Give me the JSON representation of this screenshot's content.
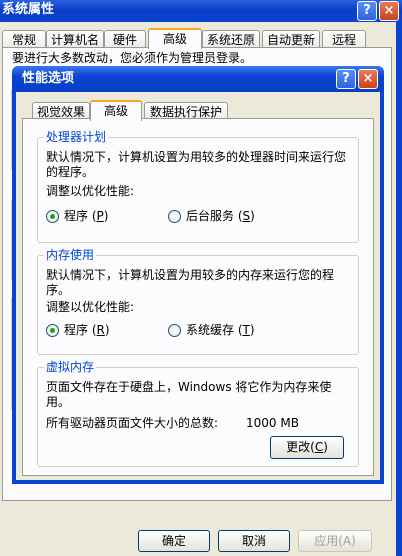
{
  "back_window": {
    "title": "系统属性",
    "tabs": [
      "常规",
      "计算机名",
      "硬件",
      "高级",
      "系统还原",
      "自动更新",
      "远程"
    ],
    "active_tab": 3,
    "note": "要进行大多数改动，您必须作为管理员登录。",
    "buttons": {
      "ok": "确定",
      "cancel": "取消",
      "apply": "应用(A)"
    }
  },
  "dialog": {
    "title": "性能选项",
    "help_glyph": "?",
    "close_glyph": "×",
    "tabs": [
      "视觉效果",
      "高级",
      "数据执行保护"
    ],
    "active_tab": 1,
    "processor": {
      "legend": "处理器计划",
      "description": "默认情况下，计算机设置为用较多的处理器时间来运行您的程序。",
      "adjust_label": "调整以优化性能:",
      "options": [
        {
          "label": "程序",
          "key": "P",
          "selected": true
        },
        {
          "label": "后台服务",
          "key": "S",
          "selected": false
        }
      ]
    },
    "memory": {
      "legend": "内存使用",
      "description": "默认情况下，计算机设置为用较多的内存来运行您的程序。",
      "adjust_label": "调整以优化性能:",
      "options": [
        {
          "label": "程序",
          "key": "R",
          "selected": true
        },
        {
          "label": "系统缓存",
          "key": "T",
          "selected": false
        }
      ]
    },
    "virtual_memory": {
      "legend": "虚拟内存",
      "description": "页面文件存在于硬盘上，Windows 将它作为内存来使用。",
      "total_label": "所有驱动器页面文件大小的总数:",
      "total_value": "1000 MB",
      "change_button": "更改",
      "change_key": "C"
    }
  },
  "colors": {
    "title_blue": "#0b44d1",
    "legend_blue": "#0046d5",
    "dialog_bg": "#ece9d8",
    "radio_dot": "#21a121"
  }
}
